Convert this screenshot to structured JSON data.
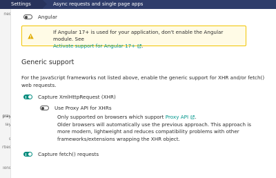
{
  "topbar": {
    "settings_label": "Settings",
    "page_title": "Async requests and single page apps"
  },
  "sidebar": {
    "fragments": [
      "ries",
      "play",
      "lay",
      "s",
      "rties",
      "ions"
    ]
  },
  "angular": {
    "label": "Angular",
    "enabled": false
  },
  "warning": {
    "text": "If Angular 17+ is used for your application, don't enable the Angular module. See",
    "link": "Activate support for Angular 17+",
    "trailing": "."
  },
  "generic": {
    "heading": "Generic support",
    "description": "For the JavaScript frameworks not listed above, enable the generic support for XHR and/or fetch() web requests."
  },
  "xhr": {
    "label": "Capture XmlHttpRequest (XHR)",
    "enabled": true
  },
  "proxy": {
    "label": "Use Proxy API for XHRs",
    "enabled": false,
    "desc_prefix": "Only supported on browsers which support",
    "desc_link": "Proxy API",
    "desc_suffix": ".",
    "desc_rest": "Older browsers will automatically use the previous approach. This approach is more modern, lightweight and reduces compatibility problems with other frameworks/extensions wrapping the XHR object."
  },
  "fetch": {
    "label": "Capture fetch() requests",
    "enabled": true
  },
  "colors": {
    "topbar": "#2f3d6b",
    "accent": "#008c7e",
    "link": "#00968c",
    "warning_border": "#f1c400",
    "warning_bg": "#fffbe6"
  }
}
